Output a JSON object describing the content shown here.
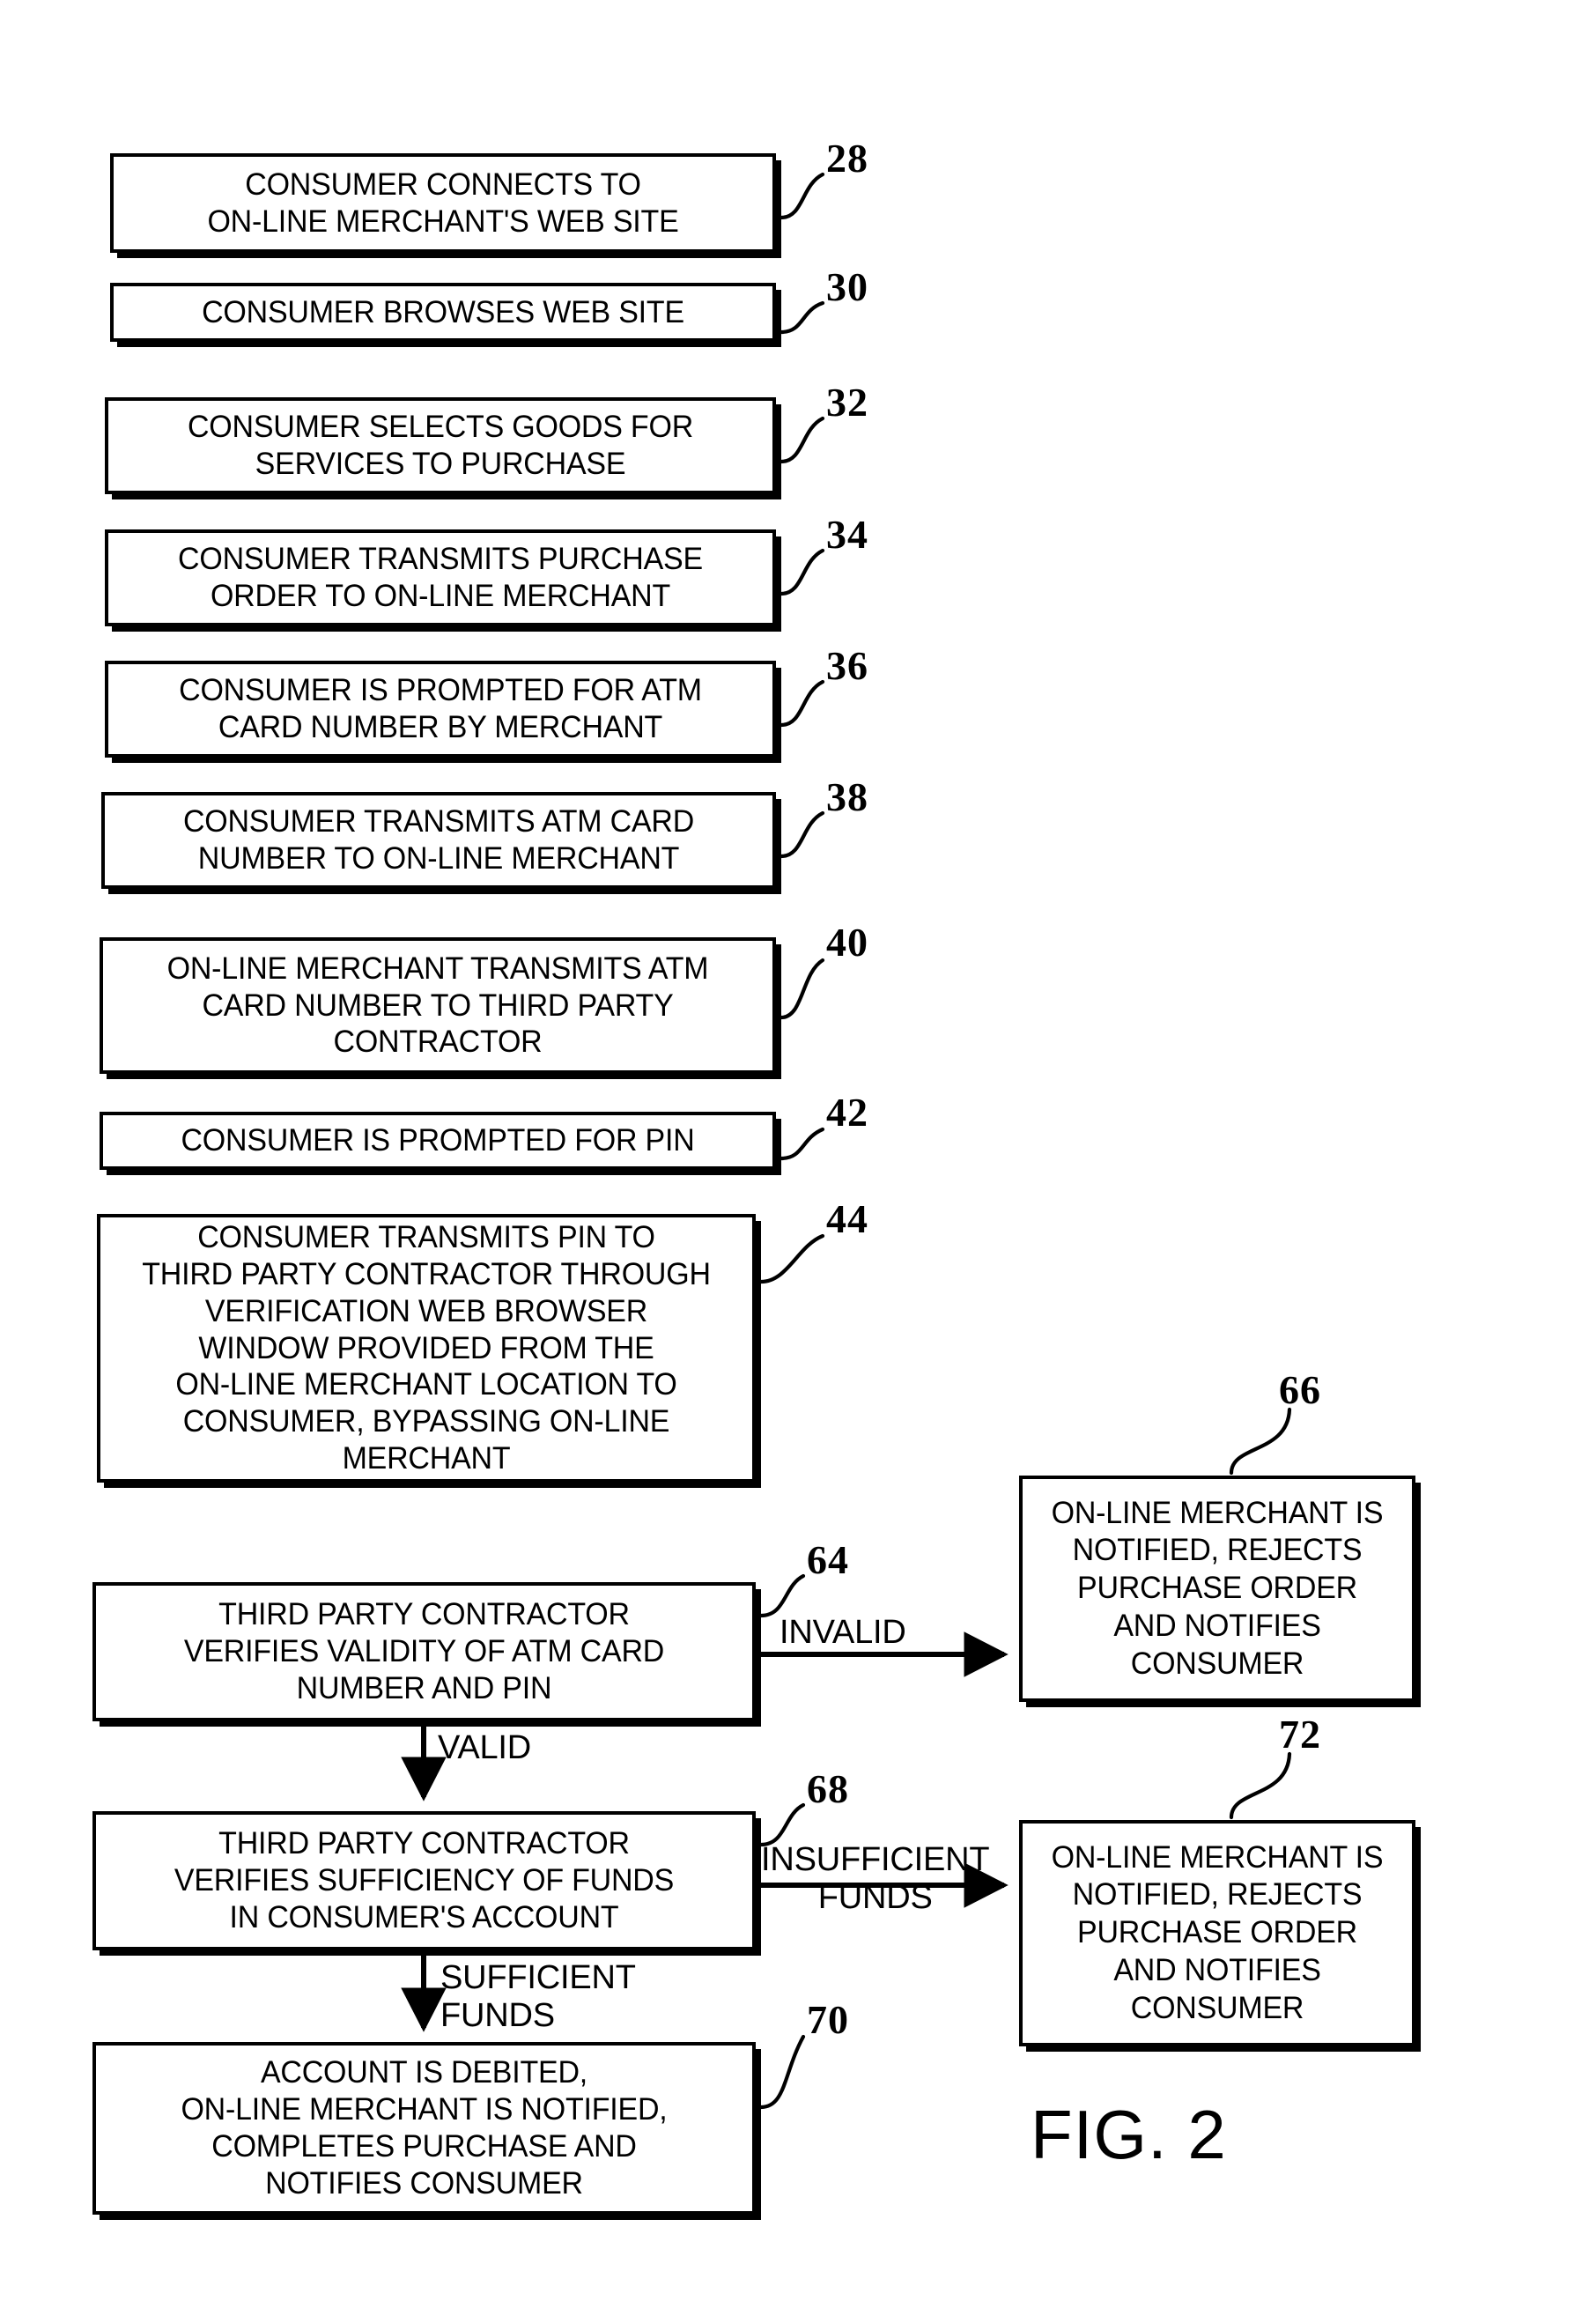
{
  "figure": {
    "caption": "FIG. 2",
    "title": "FIG. 2"
  },
  "flow_boxes": [
    {
      "ref": "28",
      "text": "CONSUMER CONNECTS TO\nON-LINE MERCHANT'S WEB SITE"
    },
    {
      "ref": "30",
      "text": "CONSUMER BROWSES WEB SITE"
    },
    {
      "ref": "32",
      "text": "CONSUMER SELECTS GOODS FOR\nSERVICES TO PURCHASE"
    },
    {
      "ref": "34",
      "text": "CONSUMER TRANSMITS PURCHASE\nORDER TO ON-LINE MERCHANT"
    },
    {
      "ref": "36",
      "text": "CONSUMER IS PROMPTED FOR ATM\nCARD NUMBER BY MERCHANT"
    },
    {
      "ref": "38",
      "text": "CONSUMER TRANSMITS ATM CARD\nNUMBER TO ON-LINE MERCHANT"
    },
    {
      "ref": "40",
      "text": "ON-LINE MERCHANT TRANSMITS ATM\nCARD NUMBER TO THIRD PARTY\nCONTRACTOR"
    },
    {
      "ref": "42",
      "text": "CONSUMER IS PROMPTED FOR PIN"
    },
    {
      "ref": "44",
      "text": "CONSUMER TRANSMITS PIN TO\nTHIRD PARTY CONTRACTOR THROUGH\nVERIFICATION WEB BROWSER\nWINDOW PROVIDED FROM THE\nON-LINE MERCHANT LOCATION TO\nCONSUMER, BYPASSING ON-LINE\nMERCHANT"
    },
    {
      "ref": "64",
      "text": "THIRD PARTY CONTRACTOR\nVERIFIES VALIDITY OF ATM CARD\nNUMBER AND PIN"
    },
    {
      "ref": "68",
      "text": "THIRD PARTY CONTRACTOR\nVERIFIES SUFFICIENCY OF FUNDS\nIN CONSUMER'S ACCOUNT"
    },
    {
      "ref": "70",
      "text": "ACCOUNT IS DEBITED,\nON-LINE MERCHANT IS NOTIFIED,\nCOMPLETES PURCHASE AND\nNOTIFIES CONSUMER"
    },
    {
      "ref": "66",
      "text": "ON-LINE MERCHANT IS\nNOTIFIED, REJECTS\nPURCHASE ORDER\nAND NOTIFIES\nCONSUMER"
    },
    {
      "ref": "72",
      "text": "ON-LINE MERCHANT IS\nNOTIFIED, REJECTS\nPURCHASE ORDER\nAND NOTIFIES\nCONSUMER"
    }
  ],
  "edge_labels": {
    "invalid": "INVALID",
    "valid": "VALID",
    "insufficient_funds": "INSUFFICIENT\nFUNDS",
    "sufficient_funds": "SUFFICIENT\nFUNDS"
  },
  "colors": {
    "ink": "#000000",
    "paper": "#ffffff"
  }
}
